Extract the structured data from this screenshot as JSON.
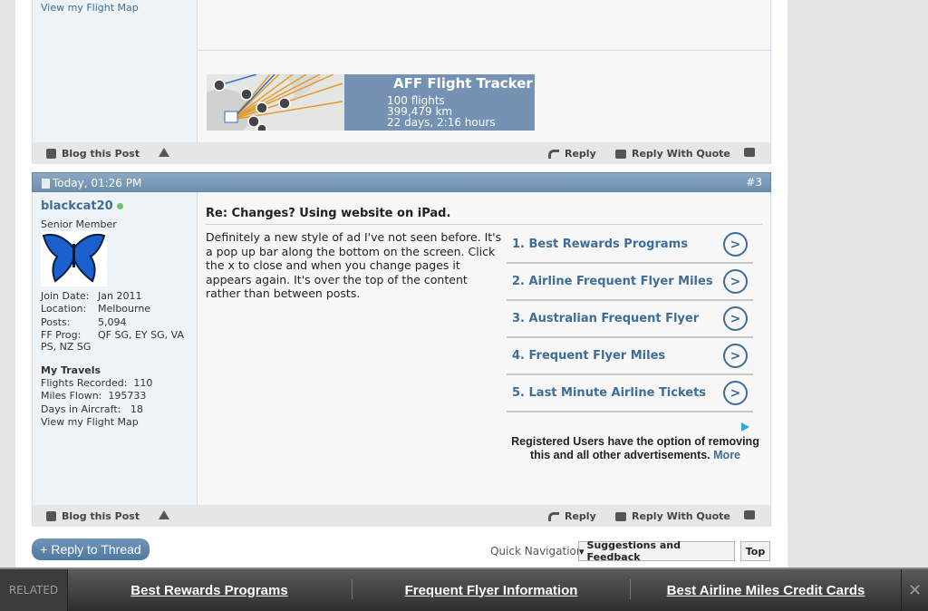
{
  "previous_post": {
    "flight_map_link": "View my Flight Map",
    "tracker": {
      "title": "AFF Flight Tracker",
      "flights": "100 flights",
      "distance": "399,479 km",
      "duration": "22 days, 2:16 hours"
    }
  },
  "post_footer": {
    "blog": "Blog this Post",
    "reply": "Reply",
    "reply_quote": "Reply With Quote"
  },
  "post": {
    "date": "Today, 01:26 PM",
    "number": "#3",
    "user": {
      "name": "blackcat20",
      "title": "Senior Member",
      "join_label": "Join Date:",
      "join_value": "Jan 2011",
      "location_label": "Location:",
      "location_value": "Melbourne",
      "posts_label": "Posts:",
      "posts_value": "5,094",
      "ffprog_label": "FF Prog:",
      "ffprog_value": "QF SG, EY SG, VA",
      "ffprog_value2": "PS, NZ SG",
      "travels_heading": "My Travels",
      "flights_label": "Flights Recorded:",
      "flights_value": "110",
      "miles_label": "Miles Flown:",
      "miles_value": "195733",
      "days_label": "Days in Aircraft:",
      "days_value": "18",
      "flight_map_link": "View my Flight Map"
    },
    "title": "Re: Changes? Using website on iPad.",
    "body": "Definitely a new style of ad I've not seen before. It's a pop up bar along the bottom on the screen. Click the x to close and when you change pages it appears again. It's over the top of the content rather than between posts."
  },
  "ads": {
    "items": [
      {
        "label": "1. Best Rewards Programs"
      },
      {
        "label": "2. Airline Frequent Flyer Miles"
      },
      {
        "label": "3. Australian Frequent Flyer"
      },
      {
        "label": "4. Frequent Flyer Miles"
      },
      {
        "label": "5. Last Minute Airline Tickets"
      }
    ],
    "arrow_icon": "chevron-right-circle-icon",
    "registered_note": "Registered Users have the option of removing this and all other advertisements.",
    "more": "More"
  },
  "controls": {
    "reply_to_thread": "+ Reply to Thread",
    "quick_nav_label": "Quick Navigation",
    "quick_nav_value": "Suggestions and Feedback",
    "top": "Top"
  },
  "related_bar": {
    "label": "RELATED",
    "links": [
      "Best Rewards Programs",
      "Frequent Flyer Information",
      "Best Airline Miles Credit Cards"
    ],
    "close": "✕"
  },
  "colors": {
    "link": "#3e6d98",
    "post_header": "#7a9aba",
    "related_bar": "#3a3a3a"
  }
}
